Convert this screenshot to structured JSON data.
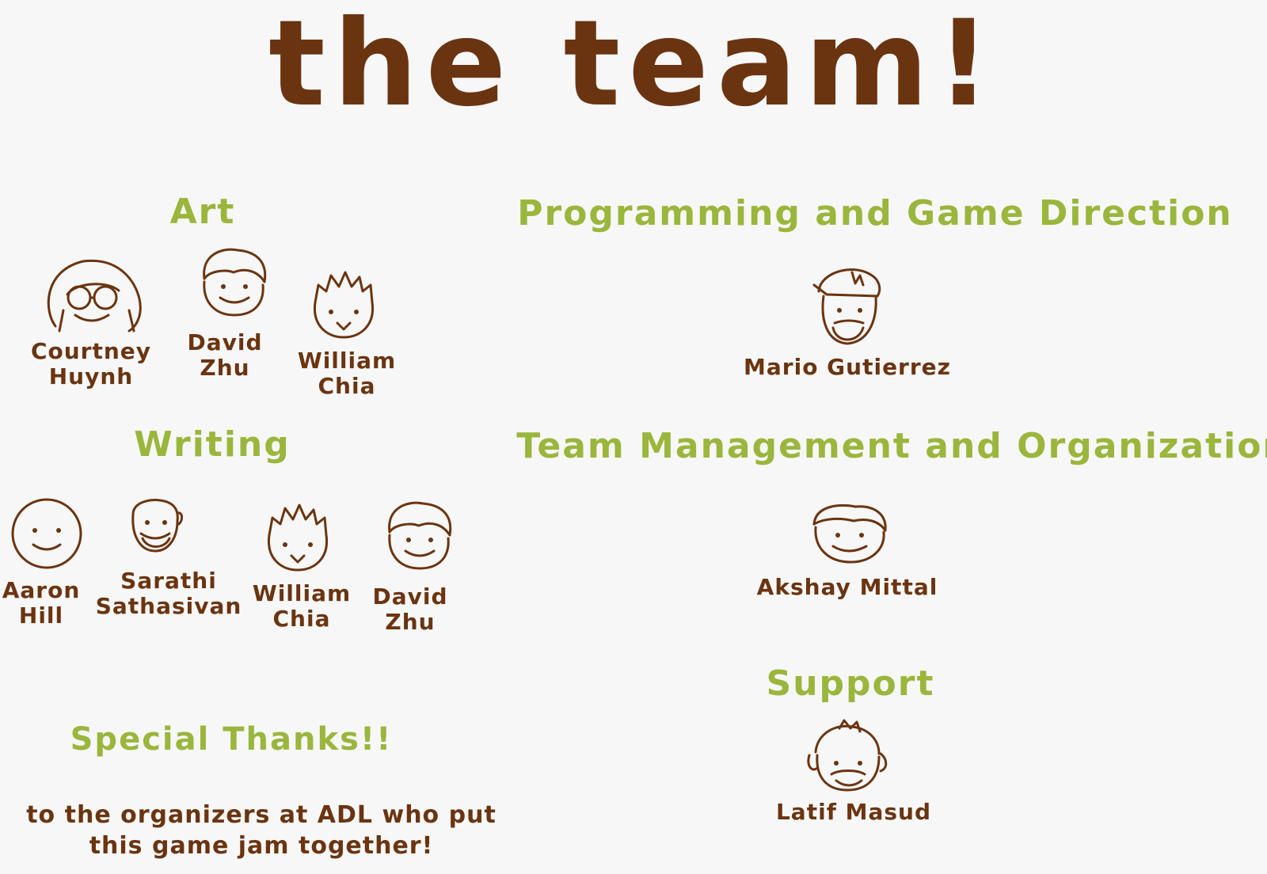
{
  "title": "the team!",
  "colors": {
    "background": "#f7f7f7",
    "ink": "#6b3410",
    "heading": "#9ab63c"
  },
  "sections": {
    "art": {
      "heading": "Art",
      "members": [
        {
          "line1": "Courtney",
          "line2": "Huynh",
          "face": "long-hair-glasses-face-icon"
        },
        {
          "line1": "David",
          "line2": "Zhu",
          "face": "fluffy-hair-smile-face-icon"
        },
        {
          "line1": "William",
          "line2": "Chia",
          "face": "spiky-hair-face-icon"
        }
      ]
    },
    "writing": {
      "heading": "Writing",
      "members": [
        {
          "line1": "Aaron",
          "line2": "Hill",
          "face": "simple-smile-face-icon"
        },
        {
          "line1": "Sarathi",
          "line2": "Sathasivan",
          "face": "beard-face-icon"
        },
        {
          "line1": "William",
          "line2": "Chia",
          "face": "spiky-hair-face-icon"
        },
        {
          "line1": "David",
          "line2": "Zhu",
          "face": "fluffy-hair-smile-face-icon"
        }
      ]
    },
    "programming": {
      "heading": "Programming and Game Direction",
      "members": [
        {
          "line1": "Mario Gutierrez",
          "face": "cap-beard-face-icon"
        }
      ]
    },
    "management": {
      "heading": "Team Management and Organization",
      "members": [
        {
          "line1": "Akshay Mittal",
          "face": "hair-smile-face-icon"
        }
      ]
    },
    "support": {
      "heading": "Support",
      "members": [
        {
          "line1": "Latif Masud",
          "face": "mustache-face-icon"
        }
      ]
    }
  },
  "special_thanks": {
    "heading": "Special Thanks!!",
    "line1": "to the organizers at ADL who put",
    "line2": "this game jam together!"
  }
}
